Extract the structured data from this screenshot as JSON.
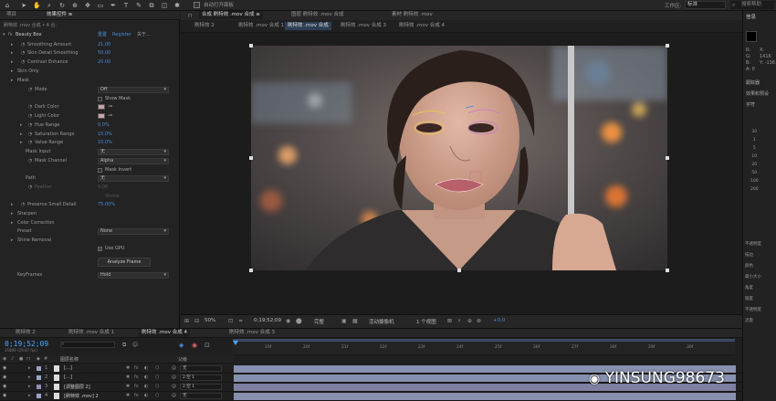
{
  "toolbar": {
    "icons": [
      "home-icon",
      "selection-icon",
      "hand-icon",
      "zoom-icon",
      "rotate-icon",
      "camera-orbit-icon",
      "pan-behind-icon",
      "rectangle-icon",
      "pen-icon",
      "type-icon",
      "brush-icon",
      "clone-icon",
      "eraser-icon",
      "roto-icon",
      "puppet-icon"
    ],
    "auto_open_panel": "自动打开面板",
    "workspace_label": "工作区:",
    "workspace_value": "标准",
    "search_placeholder": "搜索帮助"
  },
  "fx_panel": {
    "tabs": [
      "项目",
      "效果控件 ≡"
    ],
    "layer_path": "刷特效 .mov 合成 • 4 合.",
    "effect_header": {
      "name": "Beauty Box",
      "reset": "重置",
      "register": "Register",
      "about": "关于..."
    },
    "params": [
      {
        "label": "Smoothing Amount",
        "value": "21.00"
      },
      {
        "label": "Skin Detail Smoothing",
        "value": "50.00"
      },
      {
        "label": "Contrast Enhance",
        "value": "20.00"
      },
      {
        "label": "Skin Only",
        "value": ""
      },
      {
        "label": "Mask",
        "value": ""
      },
      {
        "label": "Mode",
        "value": "Off"
      },
      {
        "label": "",
        "value": "Show Mask"
      },
      {
        "label": "Dark Color",
        "value": ""
      },
      {
        "label": "Light Color",
        "value": ""
      },
      {
        "label": "Hue Range",
        "value": "0.0%"
      },
      {
        "label": "Saturation Range",
        "value": "15.0%"
      },
      {
        "label": "Value Range",
        "value": "10.0%"
      },
      {
        "label": "Mask Input",
        "value": "无"
      },
      {
        "label": "Mask Channel",
        "value": "Alpha"
      },
      {
        "label": "",
        "value": "Mask Invert"
      },
      {
        "label": "Path",
        "value": "无"
      },
      {
        "label": "Feather",
        "value": "0.00"
      },
      {
        "label": "",
        "value": "Shrink"
      },
      {
        "label": "Preserve Small Detail",
        "value": "75.00%"
      },
      {
        "label": "Sharpen",
        "value": ""
      },
      {
        "label": "Color Correction",
        "value": ""
      },
      {
        "label": "Preset",
        "value": "None"
      },
      {
        "label": "Shine Removal",
        "value": ""
      },
      {
        "label": "",
        "value": ""
      },
      {
        "label": "",
        "value": "Use GPU"
      },
      {
        "label": "",
        "value": "Analyze Frame"
      },
      {
        "label": "",
        "value": ""
      },
      {
        "label": "KeyFrames",
        "value": "Hold"
      }
    ],
    "analyze_button": "Analyze Frame",
    "dark_color": "#c4a3a3",
    "light_color": "#c8a8a8"
  },
  "composition": {
    "top_tabs": [
      "合成 刷特效 .mov 合成 ≡",
      "图层 刷特效 .mov 合成",
      "素材 刷特效 .mov"
    ],
    "sub_tabs": [
      "刷特效 2",
      "刷特效 .mov 合成 1",
      "刷特效 .mov 合成",
      "刷特效 .mov 合成 3",
      "刷特效 .mov 合成 4"
    ],
    "bottom_bar": {
      "zoom": "50%",
      "timecode": "0;19;52;09",
      "resolution": "完整",
      "camera": "活动摄像机",
      "views": "1 个视图",
      "exposure": "+0.0"
    }
  },
  "timeline": {
    "tabs": [
      "刷特效 2",
      "刷特效 .mov 合成 1",
      "刷特效 .mov 合成 4",
      "刷特效 .mov 合成 3"
    ],
    "timecode": "0;19;52;09",
    "frame_info": "35809 (29.97 fps)",
    "column_header": "图层名称",
    "parent_header": "父级",
    "ruler": [
      "19f",
      "20f",
      "21f",
      "22f",
      "23f",
      "24f",
      "25f",
      "26f",
      "27f",
      "28f",
      "29f",
      "30f"
    ],
    "layers": [
      {
        "num": "1",
        "name": "[…]",
        "parent": "无",
        "color": "#9aa4c8"
      },
      {
        "num": "2",
        "name": "[…]",
        "parent": "2.空 1",
        "color": "#9aa4c8"
      },
      {
        "num": "3",
        "name": "[调整图层 2]",
        "parent": "2.空 1",
        "color": "#8f90b8"
      },
      {
        "num": "4",
        "name": "[刷特效 .mov] 2",
        "parent": "无",
        "color": "#9aa4c8"
      }
    ]
  },
  "right_panel": {
    "title": "信息",
    "rgb": [
      "R:",
      "G:",
      "B:",
      "A: 0"
    ],
    "xy": [
      "X: 1416",
      "Y: -136"
    ],
    "section2": [
      "跟踪器",
      "效果和预设",
      "字符"
    ],
    "items": [
      "30",
      "1",
      "5",
      "10",
      "20",
      "50",
      "100",
      "200",
      "1"
    ],
    "labels": [
      "不透明度",
      "描边",
      "颜色",
      "最小大小",
      "角度",
      "圆度",
      "不透明度",
      "流量"
    ]
  },
  "watermark": "YINSUNG98673",
  "colors": {
    "accent": "#4a8bd6",
    "panel": "#232323",
    "timecode": "#4aa6ff"
  }
}
